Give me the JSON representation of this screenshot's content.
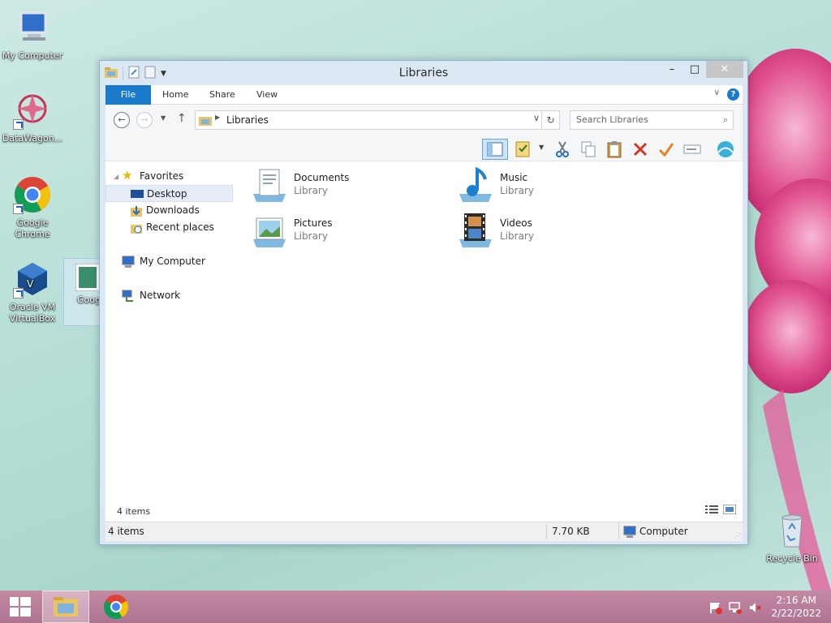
{
  "desktop": {
    "icons": [
      {
        "label": "My Computer",
        "icon": "computer-icon"
      },
      {
        "label": "DataWagon...",
        "icon": "datawagon-icon"
      },
      {
        "label": "Google Chrome",
        "icon": "chrome-icon"
      },
      {
        "label": "Oracle VM VirtualBox",
        "icon": "virtualbox-icon"
      },
      {
        "label": "Goog Chro",
        "icon": "chrome-installer-icon"
      },
      {
        "label": "Recycle Bin",
        "icon": "recycle-bin-icon"
      }
    ]
  },
  "window": {
    "title": "Libraries",
    "controls": {
      "minimize": "–",
      "maximize": "□",
      "close": "✕"
    },
    "ribbon_tabs": [
      "File",
      "Home",
      "Share",
      "View"
    ],
    "address": {
      "path": "Libraries"
    },
    "search": {
      "placeholder": "Search Libraries"
    },
    "nav": {
      "favorites": "Favorites",
      "favorites_items": [
        "Desktop",
        "Downloads",
        "Recent places"
      ],
      "my_computer": "My Computer",
      "network": "Network"
    },
    "libraries": [
      {
        "name": "Documents",
        "type": "Library"
      },
      {
        "name": "Music",
        "type": "Library"
      },
      {
        "name": "Pictures",
        "type": "Library"
      },
      {
        "name": "Videos",
        "type": "Library"
      }
    ],
    "content_status": "4 items",
    "statusbar": {
      "items": "4 items",
      "size": "7.70 KB",
      "location": "Computer"
    }
  },
  "taskbar": {
    "clock": {
      "time": "2:16 AM",
      "date": "2/22/2022"
    }
  },
  "colors": {
    "accent": "#1979ca",
    "taskbar": "#b77e98",
    "selection": "#e5eef8"
  }
}
